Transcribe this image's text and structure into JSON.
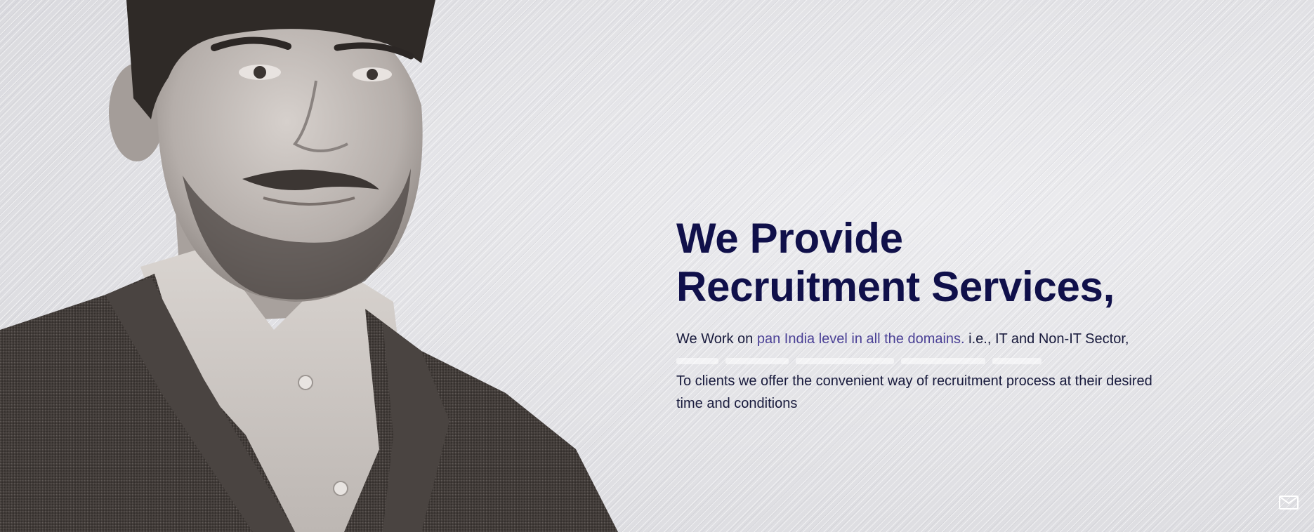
{
  "hero": {
    "headline_line1": "We Provide",
    "headline_line2": "Recruitment Services,",
    "intro_prefix": "We Work on ",
    "intro_highlight": "pan India level in all the domains.",
    "intro_suffix": " i.e., IT and Non-IT Sector,",
    "body": "To clients we offer the convenient way of recruitment process at their desired time and conditions"
  },
  "colors": {
    "headline": "#10104a",
    "highlight": "#4b4196",
    "body_text": "#181a3c",
    "background": "#e3e3e6"
  },
  "icons": {
    "contact": "mail-icon",
    "portrait": "man-in-blazer-portrait"
  }
}
